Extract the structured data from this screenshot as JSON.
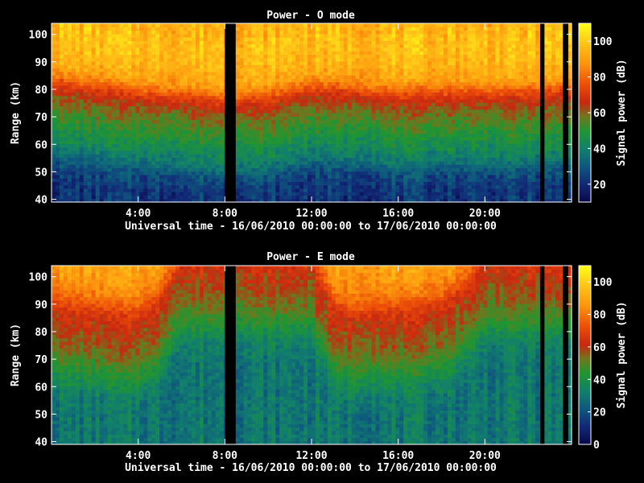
{
  "chart_data": [
    {
      "type": "heatmap",
      "title": "Power - O mode",
      "xlabel": "Universal time - 16/06/2010 00:00:00 to 17/06/2010 00:00:00",
      "ylabel": "Range (km)",
      "colorbar_label": "Signal power (dB)",
      "x_range_hours": [
        0,
        24
      ],
      "x_ticks": [
        "4:00",
        "8:00",
        "12:00",
        "16:00",
        "20:00"
      ],
      "x_tick_hours": [
        4,
        8,
        12,
        16,
        20
      ],
      "ylim": [
        39,
        104
      ],
      "y_ticks": [
        40,
        50,
        60,
        70,
        80,
        90,
        100
      ],
      "clim": [
        10,
        110
      ],
      "colorbar_ticks": [
        20,
        40,
        60,
        80,
        100
      ],
      "data_gap_hours": [
        [
          8.0,
          8.5
        ],
        [
          22.55,
          22.75
        ],
        [
          23.6,
          23.85
        ]
      ],
      "boundary_km_by_hour": [
        [
          0,
          82
        ],
        [
          2,
          80
        ],
        [
          4,
          78
        ],
        [
          6,
          77
        ],
        [
          8,
          75
        ],
        [
          10,
          76
        ],
        [
          12,
          80
        ],
        [
          14,
          79
        ],
        [
          16,
          77
        ],
        [
          18,
          78
        ],
        [
          20,
          78
        ],
        [
          22,
          78
        ],
        [
          24,
          79
        ]
      ],
      "power_profile_db_by_range": [
        [
          40,
          22
        ],
        [
          45,
          22
        ],
        [
          52,
          28
        ],
        [
          56,
          38
        ],
        [
          62,
          45
        ],
        [
          70,
          55
        ],
        [
          76,
          62
        ],
        [
          80,
          72
        ],
        [
          85,
          90
        ],
        [
          92,
          96
        ],
        [
          100,
          98
        ],
        [
          104,
          95
        ]
      ]
    },
    {
      "type": "heatmap",
      "title": "Power - E mode",
      "xlabel": "Universal time - 16/06/2010 00:00:00 to 17/06/2010 00:00:00",
      "ylabel": "Range (km)",
      "colorbar_label": "Signal power (dB)",
      "x_range_hours": [
        0,
        24
      ],
      "x_ticks": [
        "4:00",
        "8:00",
        "12:00",
        "16:00",
        "20:00"
      ],
      "x_tick_hours": [
        4,
        8,
        12,
        16,
        20
      ],
      "ylim": [
        39,
        104
      ],
      "y_ticks": [
        40,
        50,
        60,
        70,
        80,
        90,
        100
      ],
      "clim": [
        0,
        110
      ],
      "colorbar_ticks": [
        0,
        20,
        40,
        60,
        80,
        100
      ],
      "data_gap_hours": [
        [
          8.0,
          8.5
        ],
        [
          22.55,
          22.75
        ],
        [
          23.6,
          23.85
        ]
      ],
      "boundary_km_by_hour": [
        [
          0,
          88
        ],
        [
          2,
          86
        ],
        [
          4,
          84
        ],
        [
          5,
          90
        ],
        [
          6,
          104
        ],
        [
          12,
          104
        ],
        [
          13,
          88
        ],
        [
          14,
          84
        ],
        [
          16,
          86
        ],
        [
          18,
          88
        ],
        [
          19,
          94
        ],
        [
          20,
          104
        ],
        [
          24,
          104
        ]
      ],
      "power_profile_db_by_range": [
        [
          40,
          30
        ],
        [
          45,
          30
        ],
        [
          52,
          34
        ],
        [
          58,
          42
        ],
        [
          65,
          52
        ],
        [
          72,
          58
        ],
        [
          80,
          64
        ],
        [
          86,
          78
        ],
        [
          92,
          86
        ],
        [
          100,
          90
        ],
        [
          104,
          88
        ]
      ]
    }
  ]
}
